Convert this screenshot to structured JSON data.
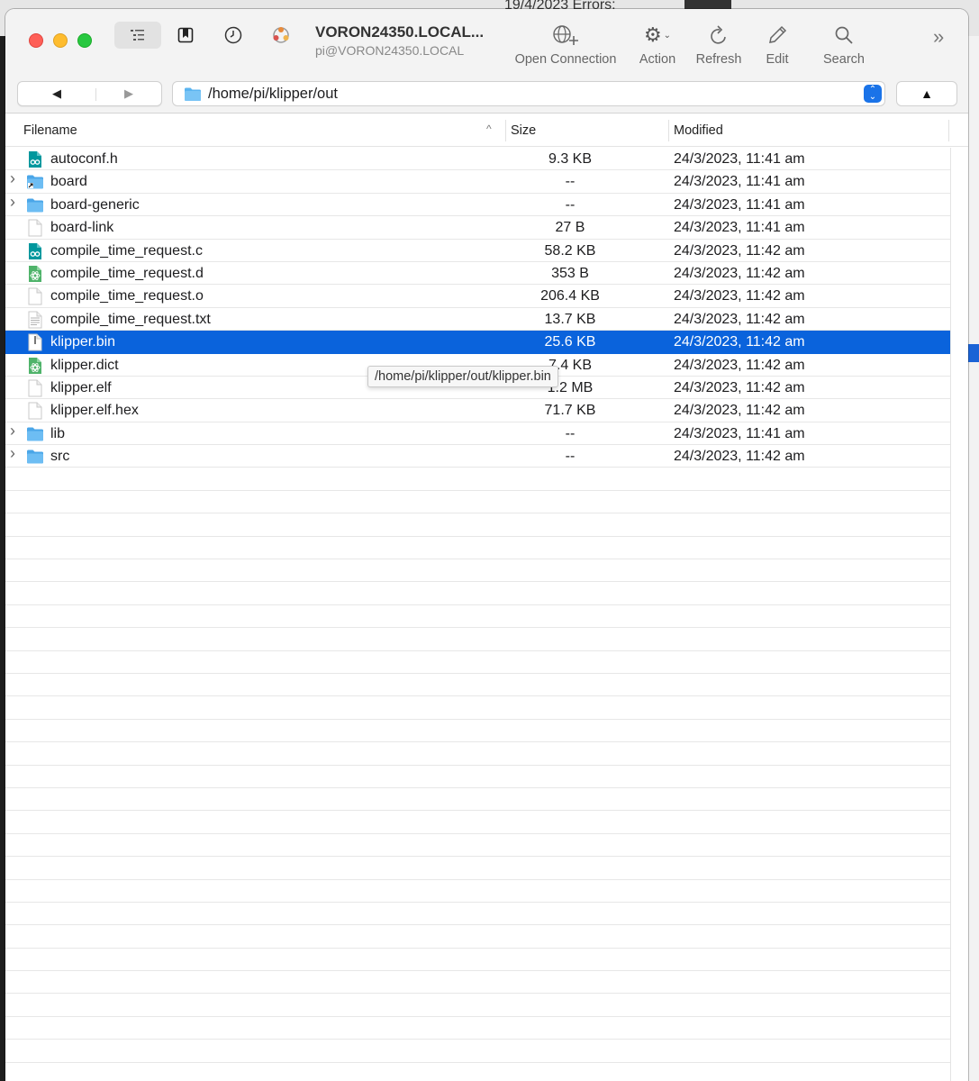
{
  "background": {
    "text": "19/4/2023  Errors:"
  },
  "connection": {
    "title": "VORON24350.LOCAL...",
    "subtitle": "pi@VORON24350.LOCAL"
  },
  "toolbar": {
    "open_connection": "Open Connection",
    "action": "Action",
    "refresh": "Refresh",
    "edit": "Edit",
    "search": "Search"
  },
  "navigation": {
    "back": "◀",
    "forward": "▶",
    "path": "/home/pi/klipper/out",
    "up": "▲"
  },
  "columns": {
    "filename": "Filename",
    "size": "Size",
    "modified": "Modified"
  },
  "files": [
    {
      "name": "autoconf.h",
      "size": "9.3 KB",
      "modified": "24/3/2023, 11:41 am",
      "icon": "arduino-file-icon",
      "folder": false
    },
    {
      "name": "board",
      "size": "--",
      "modified": "24/3/2023, 11:41 am",
      "icon": "folder-alias-icon",
      "folder": true
    },
    {
      "name": "board-generic",
      "size": "--",
      "modified": "24/3/2023, 11:41 am",
      "icon": "folder-icon",
      "folder": true
    },
    {
      "name": "board-link",
      "size": "27 B",
      "modified": "24/3/2023, 11:41 am",
      "icon": "blank-file-icon",
      "folder": false
    },
    {
      "name": "compile_time_request.c",
      "size": "58.2 KB",
      "modified": "24/3/2023, 11:42 am",
      "icon": "arduino-file-icon",
      "folder": false
    },
    {
      "name": "compile_time_request.d",
      "size": "353 B",
      "modified": "24/3/2023, 11:42 am",
      "icon": "atom-file-icon",
      "folder": false
    },
    {
      "name": "compile_time_request.o",
      "size": "206.4 KB",
      "modified": "24/3/2023, 11:42 am",
      "icon": "blank-file-icon",
      "folder": false
    },
    {
      "name": "compile_time_request.txt",
      "size": "13.7 KB",
      "modified": "24/3/2023, 11:42 am",
      "icon": "text-file-icon",
      "folder": false
    },
    {
      "name": "klipper.bin",
      "size": "25.6 KB",
      "modified": "24/3/2023, 11:42 am",
      "icon": "binary-file-icon",
      "folder": false,
      "selected": true
    },
    {
      "name": "klipper.dict",
      "size": "7.4 KB",
      "modified": "24/3/2023, 11:42 am",
      "icon": "atom-file-icon",
      "folder": false
    },
    {
      "name": "klipper.elf",
      "size": "1.2 MB",
      "modified": "24/3/2023, 11:42 am",
      "icon": "blank-file-icon",
      "folder": false
    },
    {
      "name": "klipper.elf.hex",
      "size": "71.7 KB",
      "modified": "24/3/2023, 11:42 am",
      "icon": "blank-file-icon",
      "folder": false
    },
    {
      "name": "lib",
      "size": "--",
      "modified": "24/3/2023, 11:41 am",
      "icon": "folder-icon",
      "folder": true
    },
    {
      "name": "src",
      "size": "--",
      "modified": "24/3/2023, 11:42 am",
      "icon": "folder-icon",
      "folder": true
    }
  ],
  "tooltip": "/home/pi/klipper/out/klipper.bin",
  "colors": {
    "selection": "#0a63dc",
    "folder": "#5ab4f0",
    "arduino": "#00979d",
    "close": "#fe5f57",
    "minimize": "#febc2e",
    "maximize": "#28c840"
  }
}
